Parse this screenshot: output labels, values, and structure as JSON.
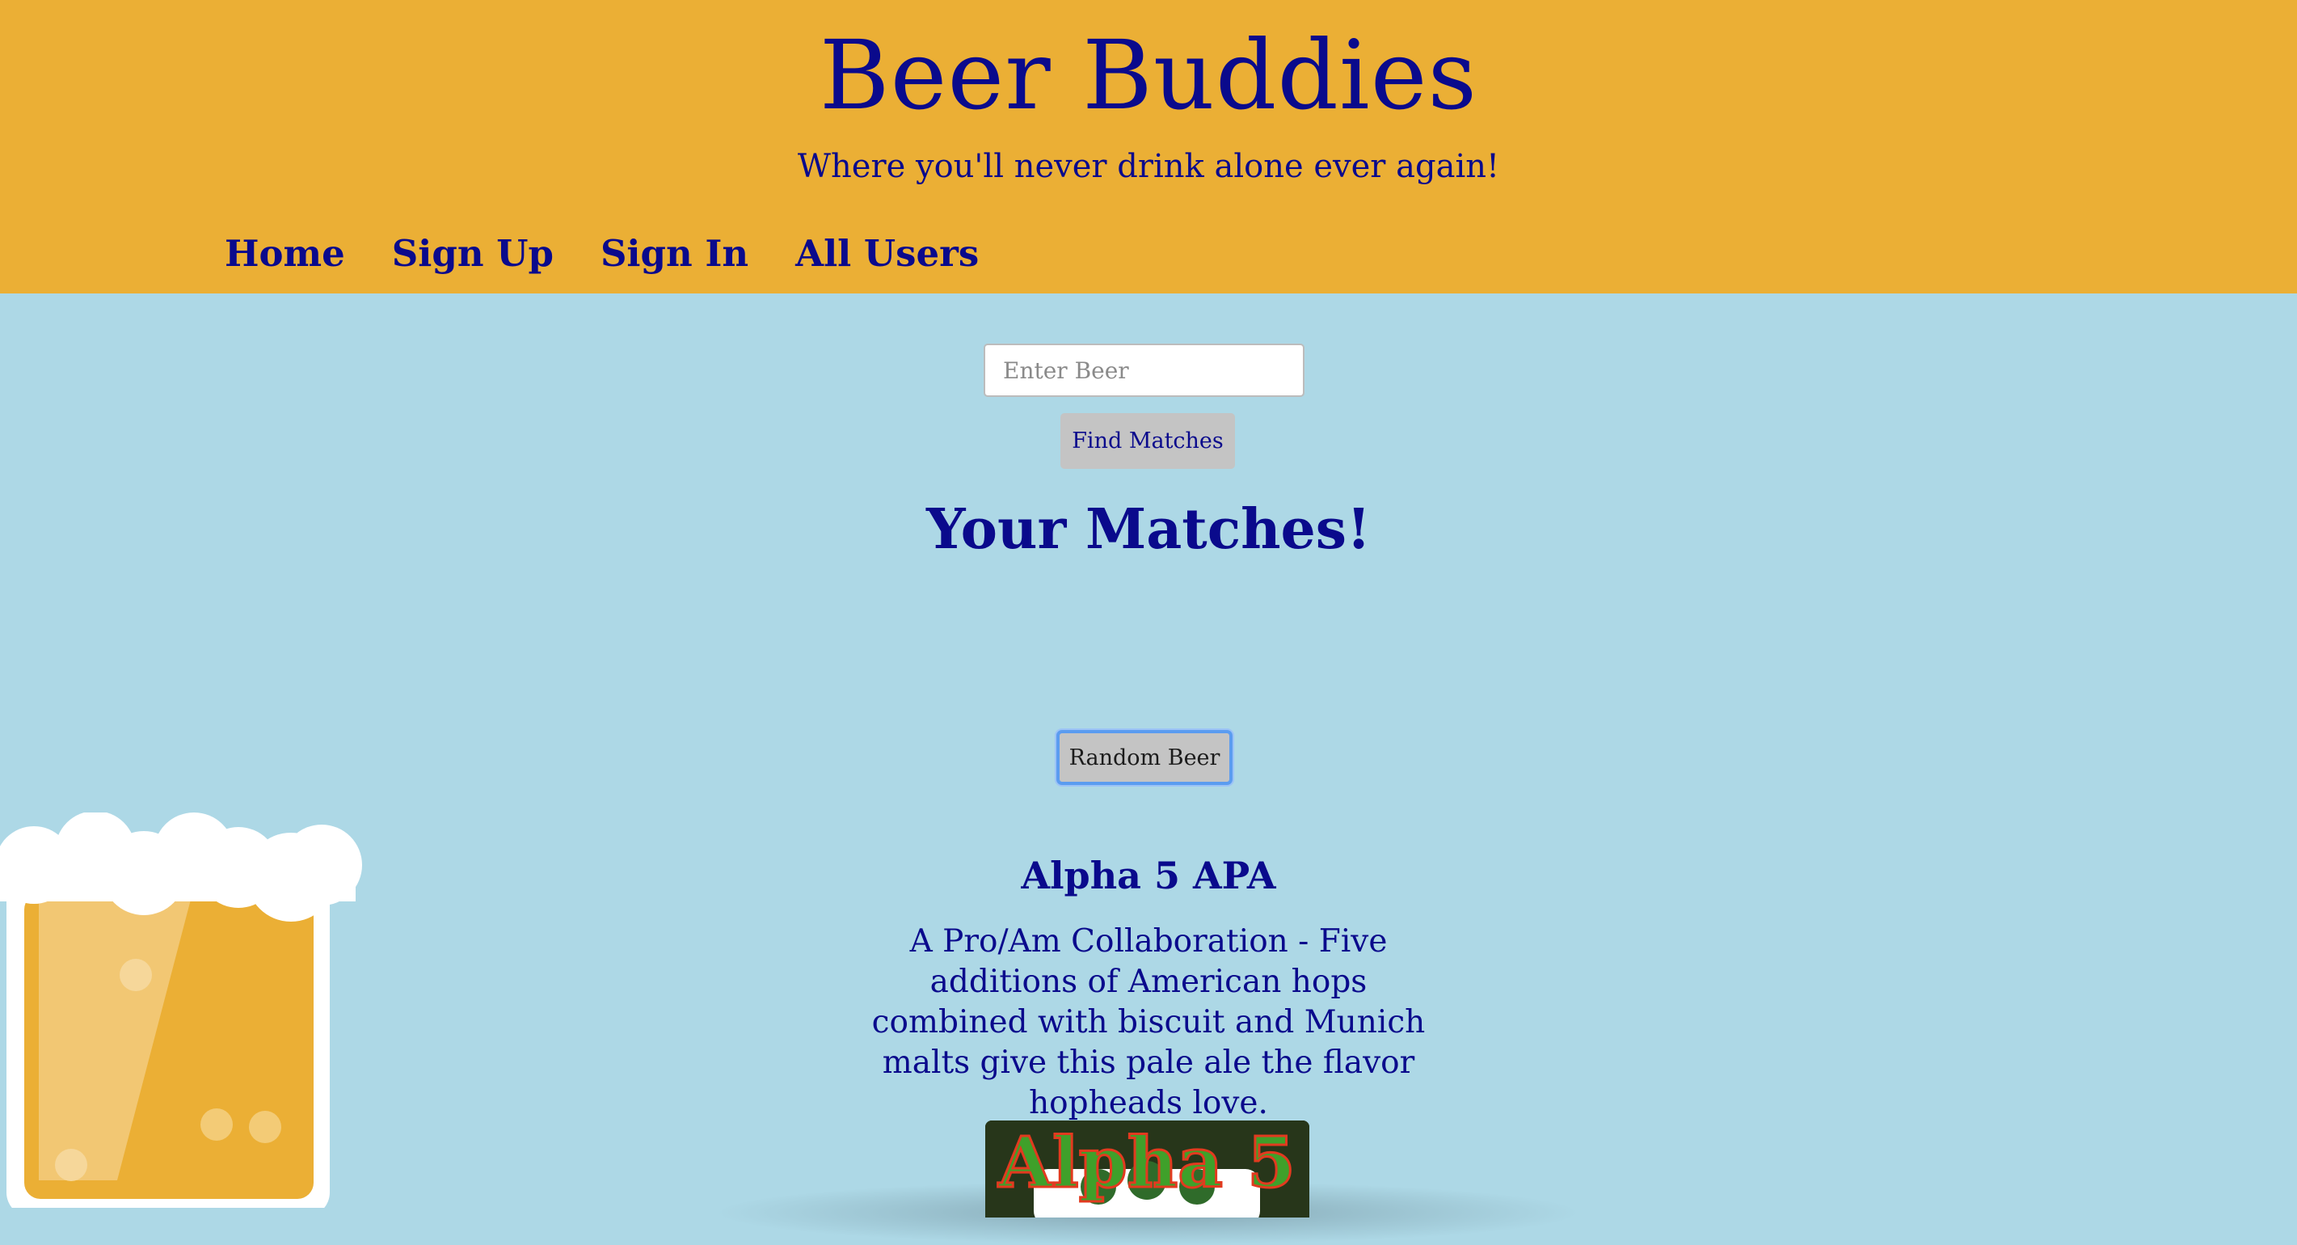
{
  "header": {
    "title": "Beer Buddies",
    "tagline": "Where you'll never drink alone ever again!"
  },
  "nav": {
    "items": [
      {
        "label": "Home"
      },
      {
        "label": "Sign Up"
      },
      {
        "label": "Sign In"
      },
      {
        "label": "All Users"
      }
    ]
  },
  "search": {
    "placeholder": "Enter Beer",
    "value": "",
    "button_label": "Find Matches"
  },
  "matches": {
    "heading": "Your Matches!"
  },
  "random": {
    "button_label": "Random Beer"
  },
  "beer": {
    "name": "Alpha 5 APA",
    "description": "A Pro/Am Collaboration - Five additions of American hops combined with biscuit and Munich malts give this pale ale the flavor hopheads love.",
    "label_text": "Alpha 5"
  },
  "colors": {
    "header_bg": "#ebaf35",
    "page_bg": "#add8e6",
    "text": "#0a0a8c",
    "button_bg": "#c4c4c4",
    "focus_ring": "#5b9cf0"
  },
  "icons": {
    "mascot": "beer-mug-icon"
  }
}
